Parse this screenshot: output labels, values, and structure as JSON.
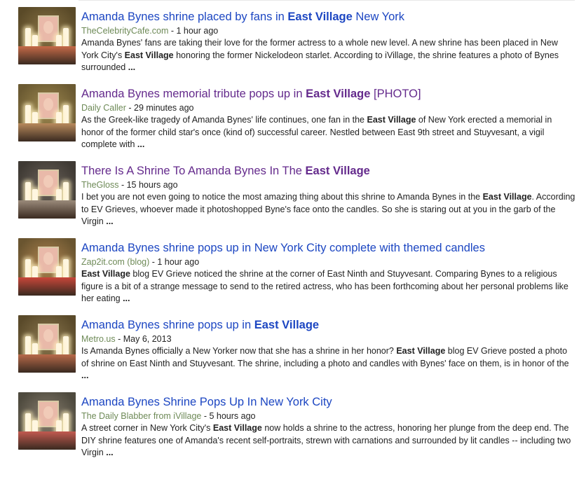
{
  "results": [
    {
      "title_before": "Amanda Bynes shrine placed by fans in ",
      "title_bold": "East Village",
      "title_after": " New York",
      "visited": false,
      "source": "TheCelebrityCafe.com",
      "time": " - 1 hour ago",
      "snippet_1": "Amanda Bynes' fans are taking their love for the former actress to a whole new level. A new shrine has been placed in New York City's ",
      "snippet_bold": "East Village",
      "snippet_2": " honoring the former Nickelodeon starlet. According to iVillage, the shrine features a photo of Bynes surrounded ",
      "ellipsis": "..."
    },
    {
      "title_before": "Amanda Bynes memorial tribute pops up in ",
      "title_bold": "East Village",
      "title_after": " [PHOTO]",
      "visited": true,
      "source": "Daily Caller",
      "time": " - 29 minutes ago",
      "snippet_1": "As the Greek-like tragedy of Amanda Bynes' life continues, one fan in the ",
      "snippet_bold": "East Village",
      "snippet_2": " of New York erected a memorial in honor of the former child star's once (kind of) successful career. Nestled between East 9th street and Stuyvesant, a vigil complete with ",
      "ellipsis": "..."
    },
    {
      "title_before": "There Is A Shrine To Amanda Bynes In The ",
      "title_bold": "East Village",
      "title_after": "",
      "visited": true,
      "source": "TheGloss",
      "time": " - 15 hours ago",
      "snippet_1": "I bet you are not even going to notice the most amazing thing about this shrine to Amanda Bynes in the ",
      "snippet_bold": "East Village",
      "snippet_2": ". According to EV Grieves, whoever made it photoshopped Byne's face onto the candles. So she is staring out at you in the garb of the Virgin ",
      "ellipsis": "..."
    },
    {
      "title_before": "Amanda Bynes shrine pops up in New York City complete with themed candles",
      "title_bold": "",
      "title_after": "",
      "visited": false,
      "source": "Zap2it.com (blog)",
      "time": " - 1 hour ago",
      "snippet_1": "",
      "snippet_bold": "East Village",
      "snippet_2": " blog EV Grieve noticed the shrine at the corner of East Ninth and Stuyvesant. Comparing Bynes to a religious figure is a bit of a strange message to send to the retired actress, who has been forthcoming about her personal problems like her eating ",
      "ellipsis": "..."
    },
    {
      "title_before": "Amanda Bynes shrine pops up in ",
      "title_bold": "East Village",
      "title_after": "",
      "visited": false,
      "source": "Metro.us",
      "time": " - May 6, 2013",
      "snippet_1": "Is Amanda Bynes officially a New Yorker now that she has a shrine in her honor? ",
      "snippet_bold": "East Village",
      "snippet_2": " blog EV Grieve posted a photo of shrine on East Ninth and Stuyvesant. The shrine, including a photo and candles with Bynes' face on them, is in honor of the ",
      "ellipsis": "..."
    },
    {
      "title_before": "Amanda Bynes Shrine Pops Up In New York City",
      "title_bold": "",
      "title_after": "",
      "visited": false,
      "source": "The Daily Blabber from iVillage",
      "time": " - 5 hours ago",
      "snippet_1": "A street corner in New York City's ",
      "snippet_bold": "East Village",
      "snippet_2": " now holds a shrine to the actress, honoring her plunge from the deep end. The DIY shrine features one of Amanda's recent self-portraits, strewn with carnations and surrounded by lit candles -- including two Virgin ",
      "ellipsis": "..."
    }
  ],
  "colors": {
    "link": "#1c46c2",
    "visited": "#642a8c",
    "source": "#6e8a57",
    "text": "#222222"
  },
  "icons": {
    "thumbnail": "shrine-photo-thumbnail"
  }
}
